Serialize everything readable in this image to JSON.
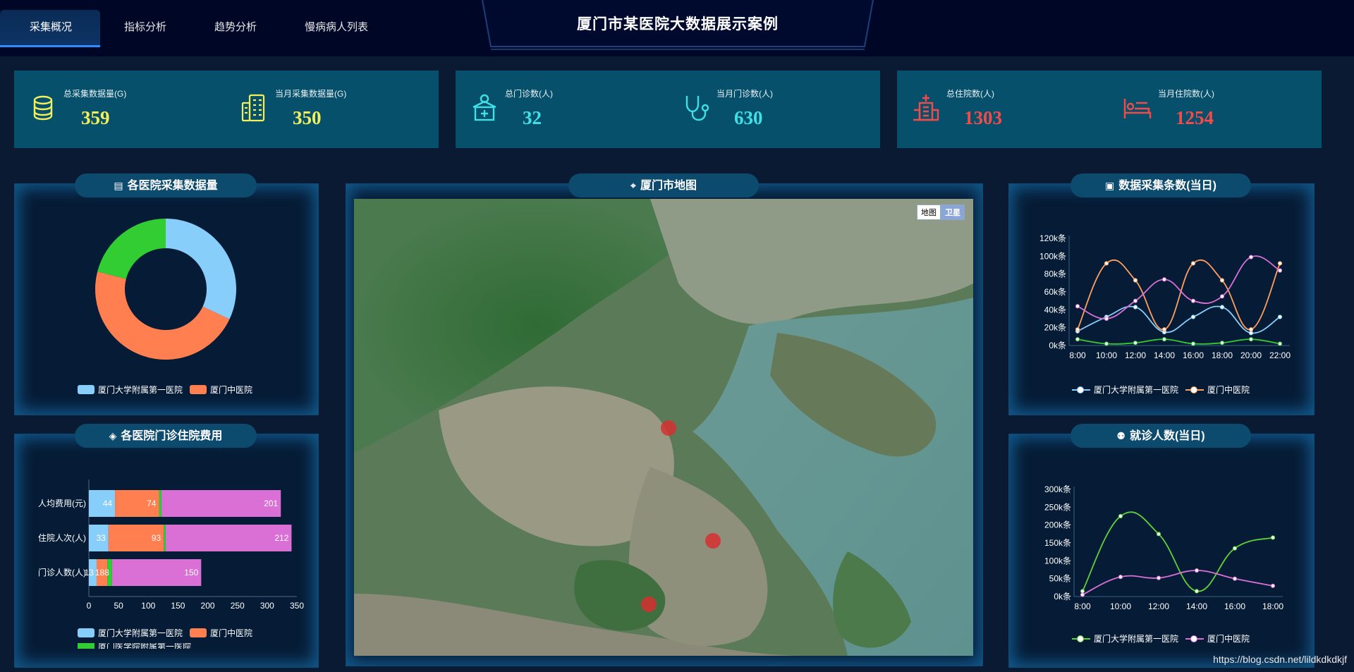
{
  "nav": {
    "tabs": [
      {
        "label": "采集概况",
        "active": true
      },
      {
        "label": "指标分析",
        "active": false
      },
      {
        "label": "趋势分析",
        "active": false
      },
      {
        "label": "慢病病人列表",
        "active": false
      }
    ]
  },
  "header": {
    "title": "厦门市某医院大数据展示案例"
  },
  "stats": [
    {
      "label": "总采集数据量(G)",
      "value": "359",
      "color": "#f4f05a",
      "icon": "database-icon"
    },
    {
      "label": "当月采集数据量(G)",
      "value": "350",
      "color": "#f4f05a",
      "icon": "server-rack-icon"
    },
    {
      "label": "总门诊数(人)",
      "value": "32",
      "color": "#3ee0e6",
      "icon": "clinic-icon"
    },
    {
      "label": "当月门诊数(人)",
      "value": "630",
      "color": "#3ee0e6",
      "icon": "stethoscope-icon"
    },
    {
      "label": "总住院数(人)",
      "value": "1303",
      "color": "#f24b4b",
      "icon": "hospital-icon"
    },
    {
      "label": "当月住院数(人)",
      "value": "1254",
      "color": "#f24b4b",
      "icon": "bed-icon"
    }
  ],
  "panels": {
    "donut_title": "各医院采集数据量",
    "fee_title": "各医院门诊住院费用",
    "map_title": "厦门市地图",
    "collect_title": "数据采集条数(当日)",
    "visit_title": "就诊人数(当日)"
  },
  "map": {
    "toggle_map": "地图",
    "toggle_satellite": "卫星",
    "markers": [
      {
        "name": "marker-1",
        "x": 0.508,
        "y": 0.502
      },
      {
        "name": "marker-2",
        "x": 0.58,
        "y": 0.748
      },
      {
        "name": "marker-3",
        "x": 0.476,
        "y": 0.888
      }
    ]
  },
  "watermark": "https://blog.csdn.net/lildkdkdkjf",
  "chart_data": [
    {
      "id": "donut",
      "type": "pie",
      "series": [
        {
          "name": "厦门大学附属第一医院",
          "value": 32,
          "color": "#87cefa"
        },
        {
          "name": "厦门中医院",
          "value": 47,
          "color": "#ff7f50"
        },
        {
          "name": "厦门医学院附属第一医院",
          "value": 21,
          "color": "#32cd32"
        }
      ],
      "legend": [
        "厦门大学附属第一医院",
        "厦门中医院"
      ]
    },
    {
      "id": "fee",
      "type": "bar",
      "orientation": "horizontal",
      "stacked": true,
      "categories": [
        "门诊人数(人)",
        "住院人次(人)",
        "人均费用(元)"
      ],
      "series": [
        {
          "name": "厦门大学附属第一医院",
          "values": [
            13,
            33,
            44
          ],
          "color": "#87cefa"
        },
        {
          "name": "厦门中医院",
          "values": [
            18,
            93,
            74
          ],
          "color": "#ff7f50"
        },
        {
          "name": "厦门医学院附属第一医院",
          "values": [
            8,
            3,
            4
          ],
          "color": "#32cd32"
        },
        {
          "name": "",
          "values": [
            150,
            212,
            201
          ],
          "color": "#da70d6"
        }
      ],
      "segment_labels": [
        [
          "13",
          "18",
          "8",
          "150"
        ],
        [
          "33",
          "93",
          "",
          "212"
        ],
        [
          "44",
          "74",
          "",
          "201"
        ]
      ],
      "xticks": [
        0,
        50,
        100,
        150,
        200,
        250,
        300,
        350
      ],
      "xlim": [
        0,
        350
      ],
      "legend": [
        "厦门大学附属第一医院",
        "厦门中医院",
        "厦门医学院附属第一医院"
      ]
    },
    {
      "id": "collect",
      "type": "line",
      "smooth": true,
      "categories": [
        "8:00",
        "10:00",
        "12:00",
        "14:00",
        "16:00",
        "18:00",
        "20:00",
        "22:00"
      ],
      "ylim": [
        0,
        120
      ],
      "yticks": [
        "0k条",
        "20k条",
        "40k条",
        "60k条",
        "80k条",
        "100k条",
        "120k条"
      ],
      "series": [
        {
          "name": "厦门大学附属第一医院",
          "values": [
            16,
            32,
            43,
            15,
            32,
            43,
            14,
            32
          ],
          "color": "#87cefa"
        },
        {
          "name": "厦门中医院",
          "values": [
            18,
            92,
            73,
            18,
            92,
            73,
            18,
            92
          ],
          "color": "#ff9f5f"
        },
        {
          "name": "",
          "values": [
            7,
            2,
            3,
            7,
            2,
            3,
            7,
            2
          ],
          "color": "#32cd32"
        },
        {
          "name": "",
          "values": [
            44,
            30,
            50,
            74,
            50,
            55,
            99,
            84
          ],
          "color": "#da70d6"
        }
      ],
      "legend": [
        "厦门大学附属第一医院",
        "厦门中医院"
      ]
    },
    {
      "id": "visits",
      "type": "line",
      "smooth": true,
      "categories": [
        "8:00",
        "10:00",
        "12:00",
        "14:00",
        "16:00",
        "18:00"
      ],
      "ylim": [
        0,
        300
      ],
      "yticks": [
        "0k条",
        "50k条",
        "100k条",
        "150k条",
        "200k条",
        "250k条",
        "300k条"
      ],
      "series": [
        {
          "name": "厦门大学附属第一医院",
          "values": [
            15,
            225,
            175,
            15,
            135,
            165
          ],
          "color": "#5ed13a"
        },
        {
          "name": "厦门中医院",
          "values": [
            5,
            55,
            52,
            73,
            50,
            30
          ],
          "color": "#da70d6"
        }
      ],
      "legend": [
        "厦门大学附属第一医院",
        "厦门中医院"
      ]
    }
  ]
}
